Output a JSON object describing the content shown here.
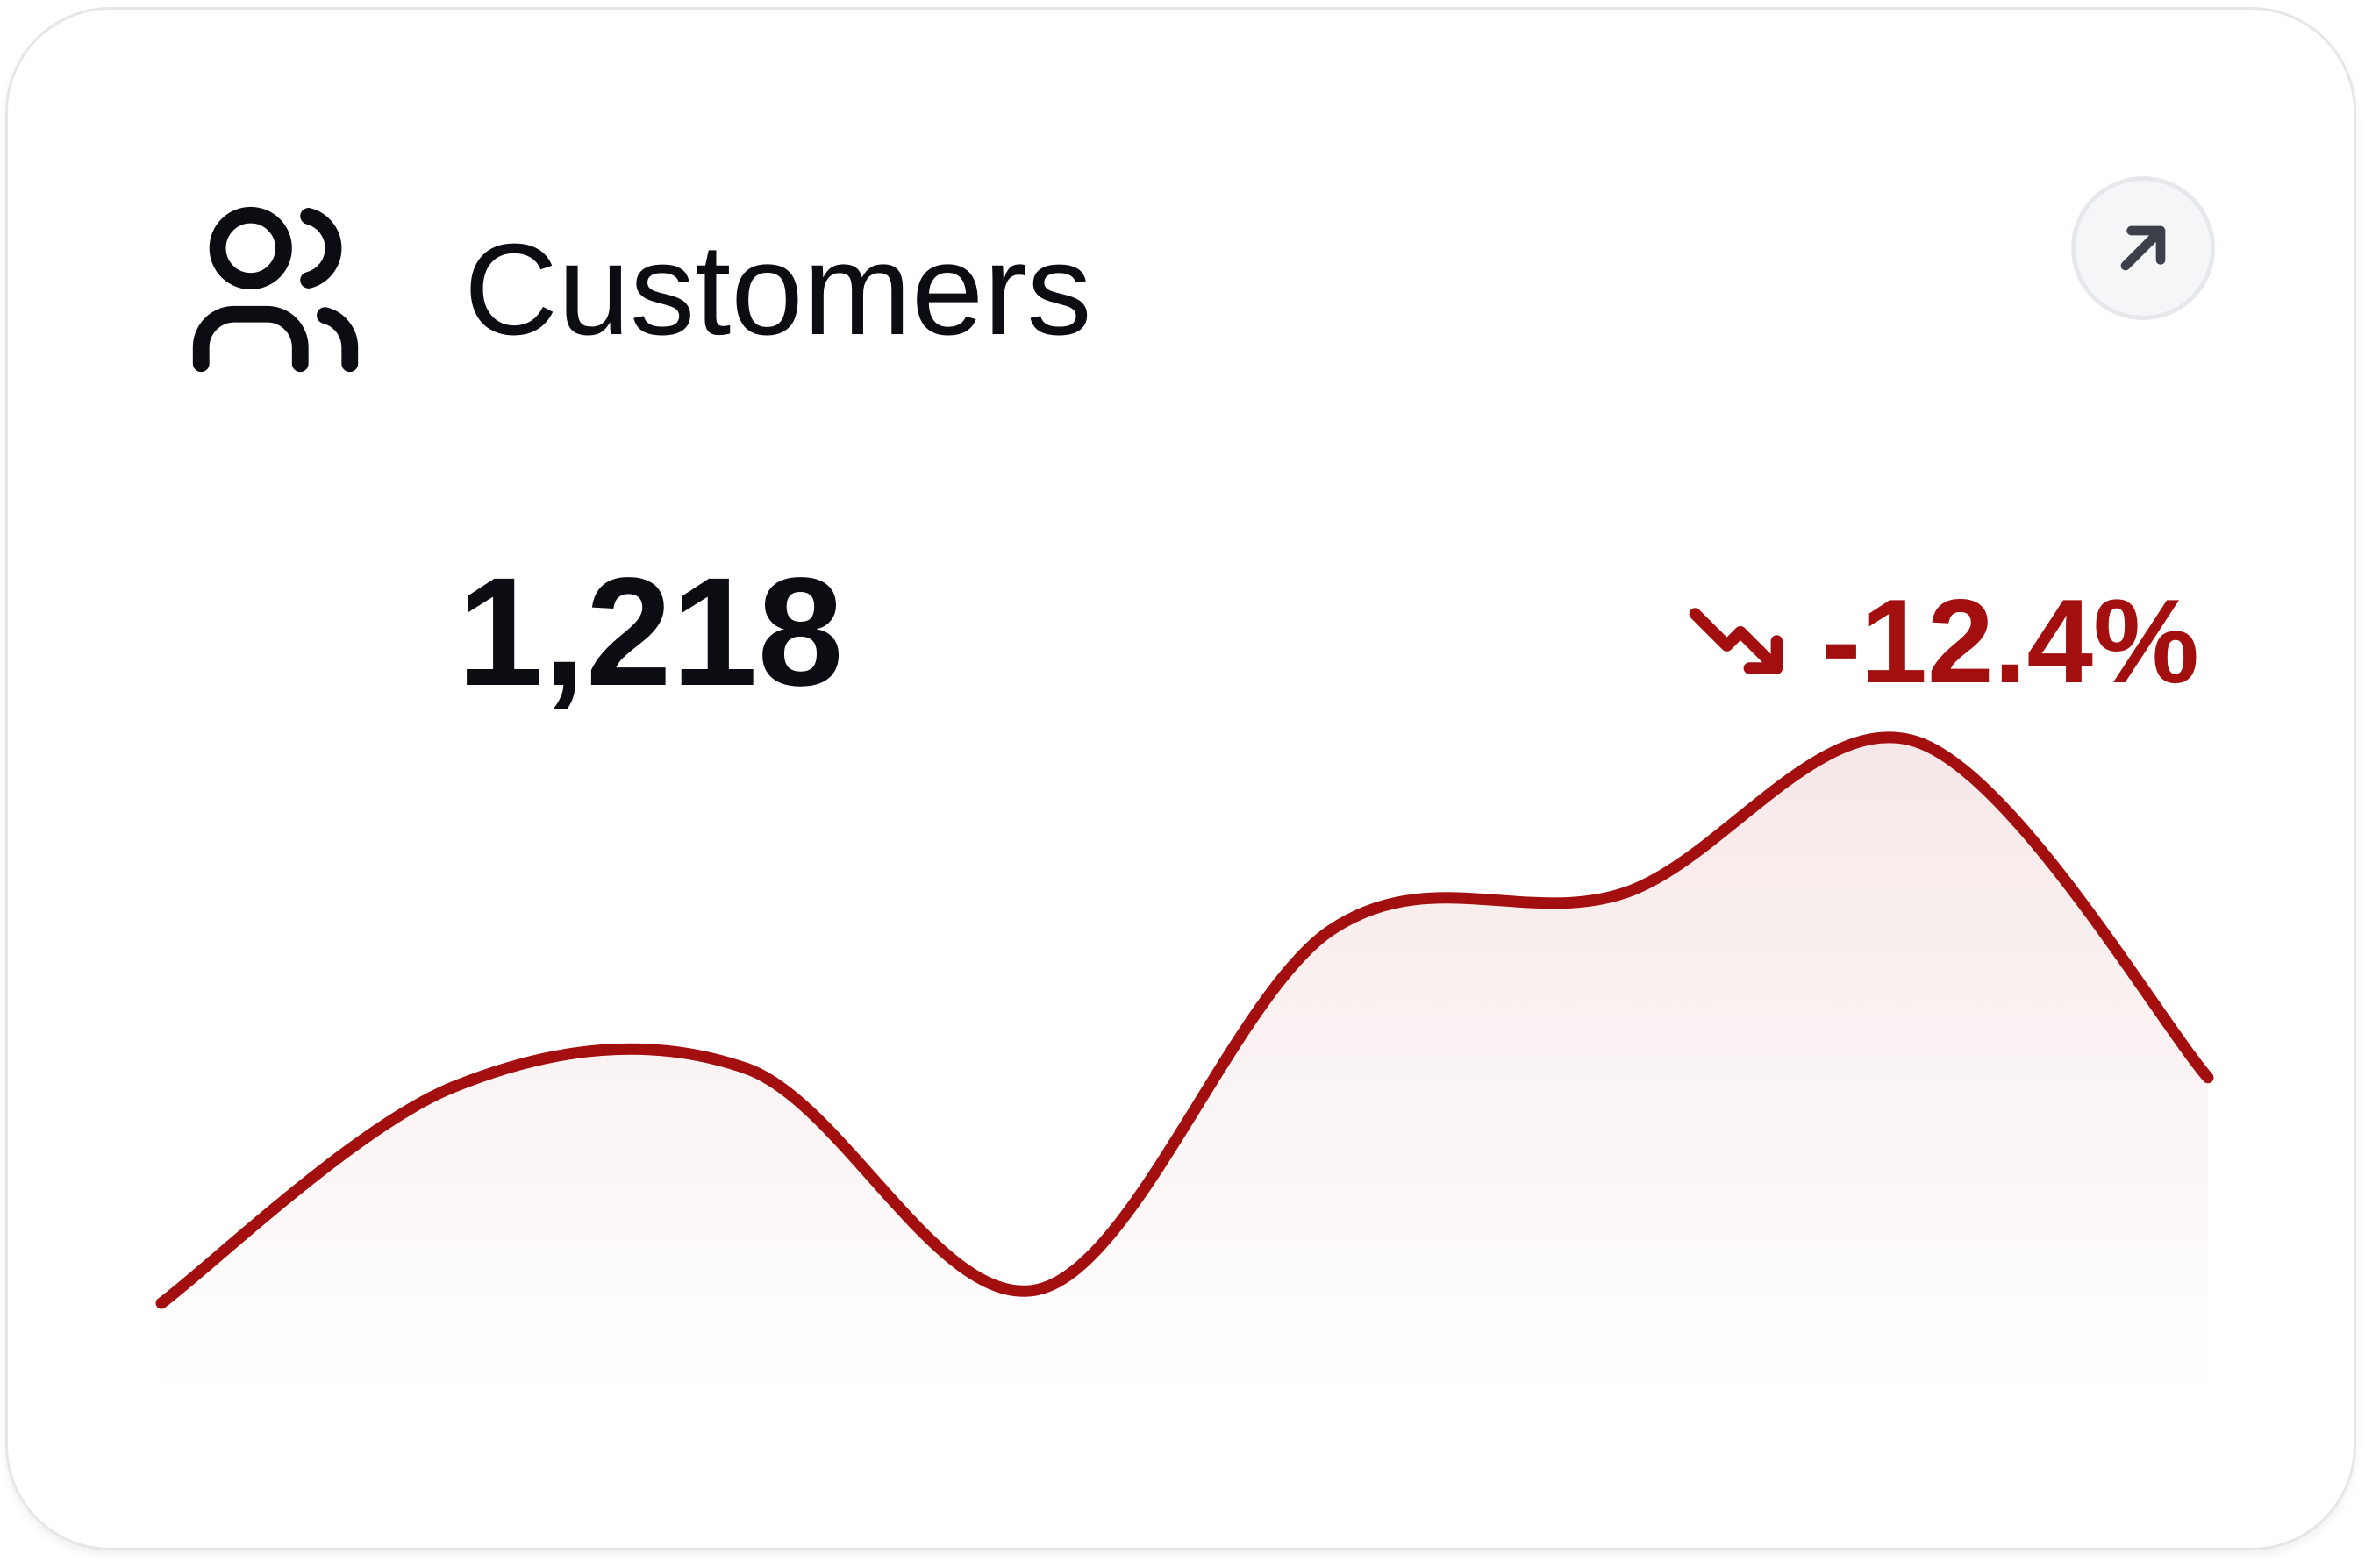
{
  "card": {
    "title": "Customers",
    "icon": "users-icon",
    "open_button_icon": "arrow-up-right-icon"
  },
  "metric": {
    "value": "1,218",
    "delta": "-12.4%",
    "delta_icon": "trending-down-icon",
    "delta_color": "#a30f0f"
  },
  "chart_data": {
    "type": "area",
    "title": "",
    "xlabel": "",
    "ylabel": "",
    "grid": false,
    "color": "#a30f0f",
    "x": [
      0,
      1,
      2,
      3,
      4,
      5,
      6,
      7
    ],
    "values": [
      0,
      0.47,
      0.51,
      0.03,
      0.81,
      0.89,
      1.22,
      0.49
    ],
    "ylim": [
      -0.2,
      1.4
    ]
  }
}
